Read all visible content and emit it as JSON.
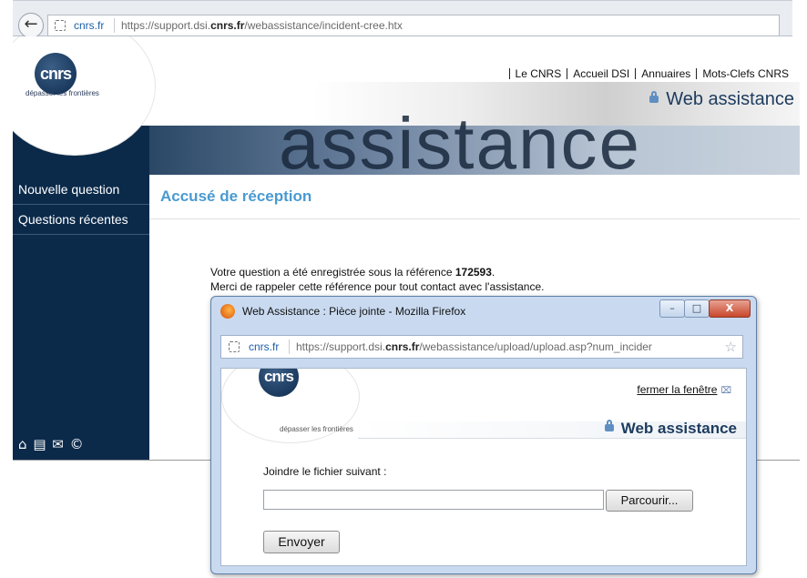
{
  "browser": {
    "site": "cnrs.fr",
    "url_prefix": "https://support.dsi.",
    "url_domain": "cnrs.fr",
    "url_suffix": "/webassistance/incident-cree.htx"
  },
  "header": {
    "logo_text": "cnrs",
    "logo_tagline": "dépasser les frontières",
    "nav": [
      "Le CNRS",
      "Accueil DSI",
      "Annuaires",
      "Mots-Clefs CNRS"
    ],
    "title": "Web assistance",
    "banner_word": "assistance"
  },
  "sidebar": {
    "items": [
      {
        "label": "Nouvelle question"
      },
      {
        "label": "Questions récentes"
      }
    ],
    "footer_icons": [
      "home-icon",
      "print-icon",
      "mail-icon",
      "copyright-icon"
    ]
  },
  "content": {
    "title": "Accusé de réception",
    "line1_prefix": "Votre question a été enregistrée sous la référence ",
    "reference": "172593",
    "line1_suffix": ".",
    "line2": "Merci de rappeler cette référence pour tout contact avec l'assistance."
  },
  "popup": {
    "title": "Web Assistance : Pièce jointe - Mozilla Firefox",
    "site": "cnrs.fr",
    "url_prefix": "https://support.dsi.",
    "url_domain": "cnrs.fr",
    "url_suffix": "/webassistance/upload/upload.asp?num_incider",
    "logo_text": "cnrs",
    "logo_tagline": "dépasser les frontières",
    "close_link": "fermer la fenêtre",
    "title_right": "Web assistance",
    "label": "Joindre le fichier suivant :",
    "file_value": "",
    "browse_label": "Parcourir...",
    "send_label": "Envoyer",
    "win_minimize": "–",
    "win_maximize": "□",
    "win_close": "X"
  }
}
